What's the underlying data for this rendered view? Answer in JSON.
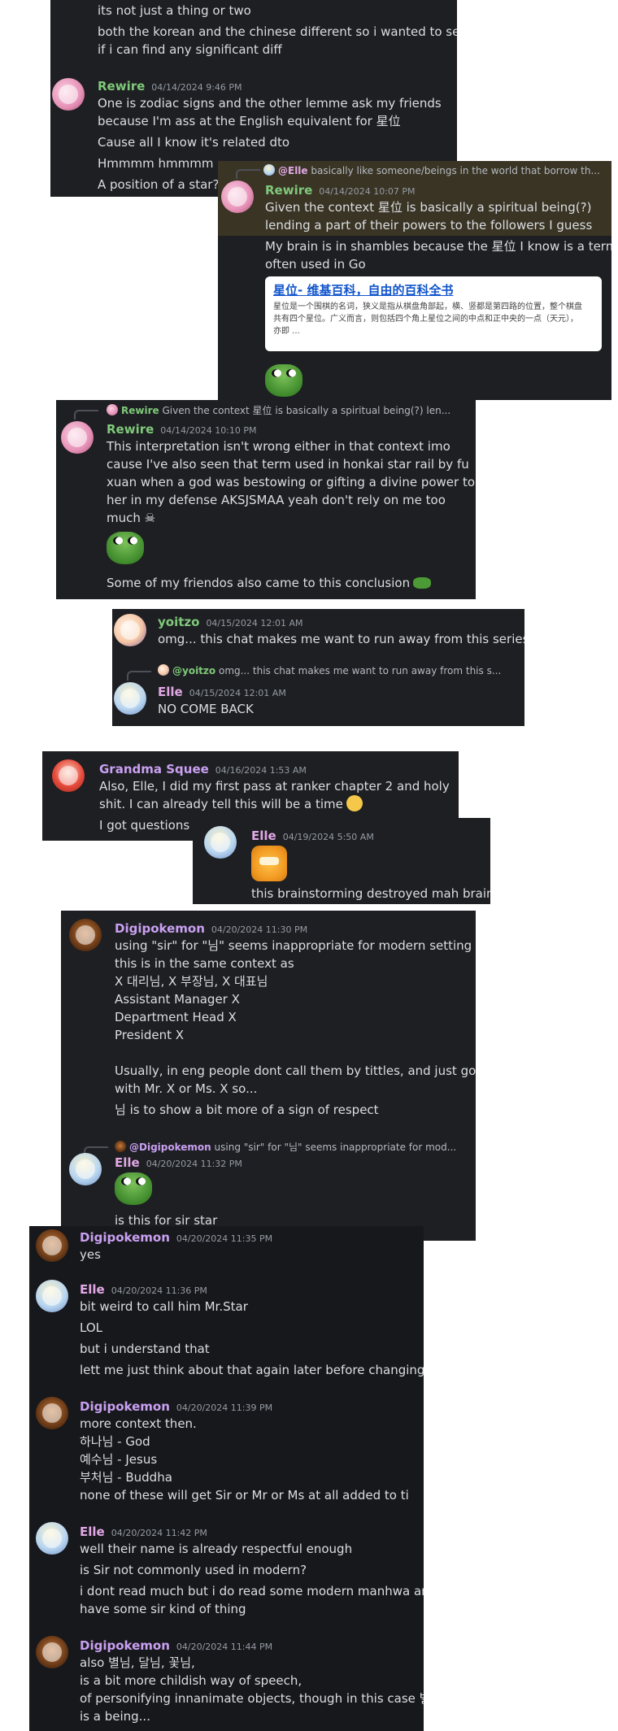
{
  "shot1": {
    "lines": [
      "its not just a thing or two",
      "both the korean and the chinese different so i wanted to see",
      "if i can find any significant diff"
    ],
    "msg": {
      "author": "Rewire",
      "time": "04/14/2024 9:46 PM",
      "lines": [
        "One is zodiac signs and the other lemme ask my friends",
        "because I'm ass at the English equivalent for 星位",
        "Cause all I know it's related dto",
        "Hmmmm hmmmm",
        "A position of a star?"
      ]
    }
  },
  "shot2": {
    "reply": {
      "name": "@Elle",
      "text": "basically like someone/beings in the world that borrow th..."
    },
    "author": "Rewire",
    "time": "04/14/2024 10:07 PM",
    "lines": [
      "Given the context 星位 is basically a spiritual being(?)",
      "lending a part of their powers to the followers I guess",
      "My brain is in shambles because the 星位 I know is a term",
      "often used in Go"
    ],
    "embed": {
      "title": "星位- 维基百科，自由的百科全书",
      "desc_l1": "星位是一个围棋的名词，狭义是指从棋盘角部起，横、竖都是第四路的位置，整个棋盘",
      "desc_l2": "共有四个星位。广义而言，则包括四个角上星位之间的中点和正中央的一点（天元），",
      "desc_l3": "亦即 ..."
    }
  },
  "shot3": {
    "reply": {
      "name": "Rewire",
      "text": "Given the context 星位 is basically a spiritual being(?) len..."
    },
    "author": "Rewire",
    "time": "04/14/2024 10:10 PM",
    "lines": [
      "This interpretation isn't wrong either in that context imo",
      "cause I've also seen that term used in honkai star rail by fu",
      "xuan when a god was bestowing or gifting a divine power to",
      "her in my defense AKSJSMAA yeah don't rely on me too",
      "much"
    ],
    "skull": "☠",
    "last_line": "Some of my friendos also came to this conclusion"
  },
  "shot4": {
    "msg1": {
      "author": "yoitzo",
      "time": "04/15/2024 12:01 AM",
      "line": "omg... this chat makes me want to run away from this series"
    },
    "reply": {
      "name": "@yoitzo",
      "text": "omg... this chat makes me want to run away from this s..."
    },
    "msg2": {
      "author": "Elle",
      "time": "04/15/2024 12:01 AM",
      "line": "NO COME BACK"
    }
  },
  "shot5": {
    "author": "Grandma Squee",
    "time": "04/16/2024 1:53 AM",
    "lines": [
      "Also, Elle, I did my first pass at ranker chapter 2 and holy",
      "shit. I can already tell this will be a time",
      "I got questions"
    ]
  },
  "shot6": {
    "author": "Elle",
    "time": "04/19/2024 5:50 AM",
    "line": "this brainstorming destroyed mah brain"
  },
  "shot7": {
    "author": "Digipokemon",
    "time": "04/20/2024 11:30 PM",
    "lines": [
      "using \"sir\"  for \"님\" seems inappropriate for  modern setting",
      "this is in the same context as",
      "X 대리님, X 부장님, X 대표님",
      "Assistant Manager X",
      "Department Head X",
      "President X",
      "",
      "Usually, in eng people dont call them by tittles, and just go",
      "with Mr. X or Ms. X so...",
      "님 is to show a bit more of a sign of respect"
    ],
    "reply": {
      "name": "@Digipokemon",
      "text": "using \"sir\"  for \"님\" seems inappropriate for  mod..."
    },
    "msg2": {
      "author": "Elle",
      "time": "04/20/2024 11:32 PM",
      "line": "is this for sir star"
    }
  },
  "shot8": {
    "m1": {
      "author": "Digipokemon",
      "time": "04/20/2024 11:35 PM",
      "lines": [
        "yes"
      ]
    },
    "m2": {
      "author": "Elle",
      "time": "04/20/2024 11:36 PM",
      "lines": [
        "bit weird to call him Mr.Star",
        "LOL",
        "but i understand that",
        "lett me just think about that again later before changing"
      ]
    },
    "m3": {
      "author": "Digipokemon",
      "time": "04/20/2024 11:39 PM",
      "lines": [
        "more context then.",
        "하나님 - God",
        "예수님 - Jesus",
        "부처님  - Buddha",
        "none of these will get Sir or Mr or Ms at all added to ti"
      ]
    },
    "m4": {
      "author": "Elle",
      "time": "04/20/2024 11:42 PM",
      "lines": [
        "well their name is already respectful enough",
        "is Sir not commonly used in modern?",
        "i dont read much but i do read some modern manhwa and",
        "have some sir kind of thing"
      ]
    },
    "m5": {
      "author": "Digipokemon",
      "time": "04/20/2024 11:44 PM",
      "lines": [
        "also 별님, 달님, 꽃님,",
        "is a bit more childish way of speech,",
        "of personifying innanimate objects, though in this case 별님",
        "is a being..."
      ]
    }
  },
  "colors": {
    "bg": "#1e1f22",
    "text": "#dbdee1",
    "timestamp": "#949ba4",
    "rewire": "#7fc97a",
    "elle": "#e2a8e6",
    "digipokemon": "#c9a0f2"
  }
}
